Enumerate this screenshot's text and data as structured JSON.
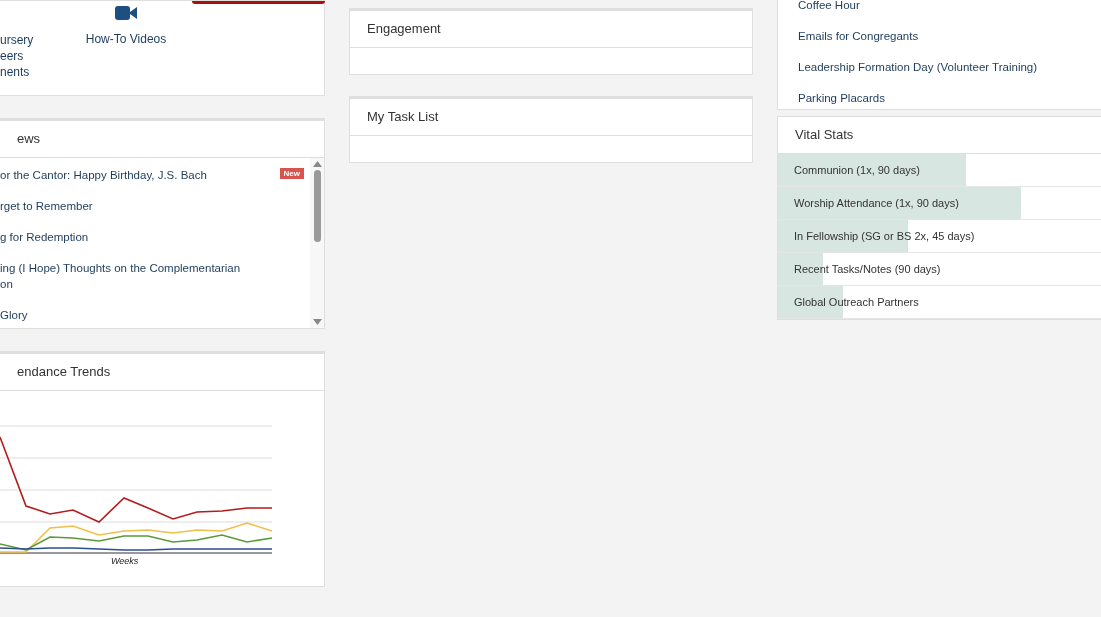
{
  "quick_links": [
    {
      "kind": "text",
      "lines": [
        "ursery",
        "eers",
        "nents"
      ]
    },
    {
      "kind": "video",
      "lines": [
        "How-To Videos"
      ]
    }
  ],
  "news": {
    "title": "ews",
    "items": [
      {
        "title": "or the Cantor: Happy Birthday, J.S. Bach",
        "badge": "New"
      },
      {
        "title": "rget to Remember"
      },
      {
        "title": "g for Redemption"
      },
      {
        "title": "ing (I Hope) Thoughts on the Complementarian on"
      },
      {
        "title": "Glory"
      }
    ]
  },
  "attendance": {
    "title": "endance Trends",
    "xlabel": "Weeks"
  },
  "engagement": {
    "title": "Engagement"
  },
  "task_list": {
    "title": "My Task List"
  },
  "links": [
    "Coffee Hour",
    "Emails for Congregants",
    "Leadership Formation Day (Volunteer Training)",
    "Parking Placards"
  ],
  "vital_stats": {
    "title": "Vital Stats",
    "rows": [
      {
        "label": "Communion (1x, 90 days)",
        "level": 0.58
      },
      {
        "label": "Worship Attendance (1x, 90 days)",
        "level": 0.75
      },
      {
        "label": "In Fellowship (SG or BS 2x, 45 days)",
        "level": 0.4
      },
      {
        "label": "Recent Tasks/Notes (90 days)",
        "level": 0.14
      },
      {
        "label": "Global Outreach Partners",
        "level": 0.2
      }
    ]
  }
}
